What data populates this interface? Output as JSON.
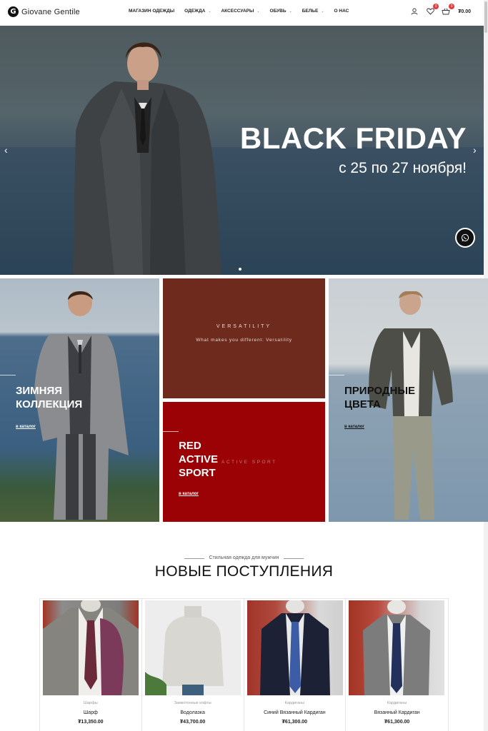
{
  "header": {
    "logo_mark": "G",
    "logo_text": "Giovane Gentile",
    "nav": [
      {
        "label": "МАГАЗИН ОДЕЖДЫ",
        "has_dropdown": false
      },
      {
        "label": "ОДЕЖДА",
        "has_dropdown": true
      },
      {
        "label": "АКСЕССУАРЫ",
        "has_dropdown": true
      },
      {
        "label": "ОБУВЬ",
        "has_dropdown": true
      },
      {
        "label": "БЕЛЬЕ",
        "has_dropdown": true
      },
      {
        "label": "О НАС",
        "has_dropdown": false
      }
    ],
    "wishlist_count": "0",
    "cart_count": "0",
    "cart_total": "₮0.00",
    "icons": [
      "user-icon",
      "heart-icon",
      "basket-icon",
      "chevron-down-icon"
    ]
  },
  "hero": {
    "title": "BLACK FRIDAY",
    "subtitle": "с 25 по 27 ноября!",
    "prev": "‹",
    "next": "›"
  },
  "tiles": {
    "winter": {
      "heading_1": "ЗИМНЯЯ",
      "heading_2": "КОЛЛЕКЦИЯ",
      "link": "в каталог"
    },
    "versatility": {
      "title": "VERSATILITY",
      "subtitle": "What makes you different: Versatility"
    },
    "red_active": {
      "heading_1": "RED",
      "heading_2": "ACTIVE",
      "heading_3": "SPORT",
      "ghost": "ACTIVE SPORT",
      "link": "в каталог"
    },
    "natural": {
      "heading_1": "ПРИРОДНЫЕ",
      "heading_2": "ЦВЕТА",
      "link": "в каталог"
    }
  },
  "new_arrivals": {
    "kicker": "Стильная одежда для мужчин",
    "title": "НОВЫЕ ПОСТУПЛЕНИЯ",
    "products": [
      {
        "category": "Шарфы",
        "name": "Шарф",
        "price": "₮13,350.00"
      },
      {
        "category": "Замкотонные кофты",
        "name": "Водолазка",
        "price": "₮43,700.00"
      },
      {
        "category": "Кардиганы",
        "name": "Синий Вязанный Кардиган",
        "price": "₮61,300.00"
      },
      {
        "category": "Кардиганы",
        "name": "Вязанный Кардиган",
        "price": "₮61,300.00"
      }
    ]
  },
  "colors": {
    "accent_badge": "#e23b3b",
    "versatility_bg": "#6e2a1d",
    "red_active_bg": "#9b0206"
  }
}
